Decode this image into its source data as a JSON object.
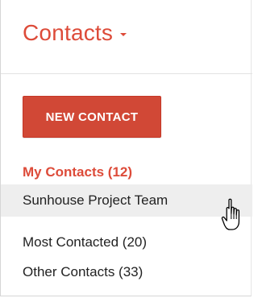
{
  "header": {
    "title": "Contacts",
    "title_dropdown_icon": "caret-down-icon",
    "accent_color": "#dd4b39"
  },
  "actions": {
    "new_contact_label": "NEW CONTACT",
    "button_color": "#d14836"
  },
  "sidebar": {
    "items": [
      {
        "label": "My Contacts (12)",
        "state": "selected"
      },
      {
        "label": "Sunhouse Project Team",
        "state": "hovered"
      },
      {
        "label": "Most Contacted (20)",
        "state": "normal"
      },
      {
        "label": "Other Contacts (33)",
        "state": "normal"
      }
    ]
  },
  "cursor": {
    "icon": "hand-pointer-icon"
  }
}
